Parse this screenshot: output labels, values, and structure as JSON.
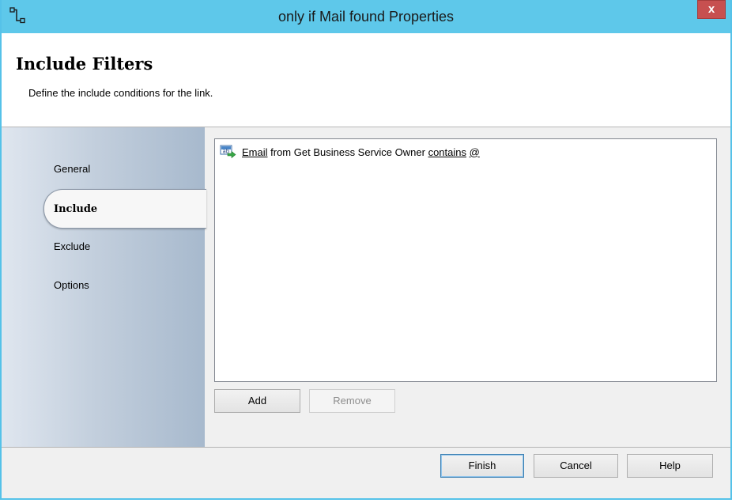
{
  "window": {
    "title": "only if Mail found Properties",
    "close_label": "x"
  },
  "header": {
    "title": "Include Filters",
    "subtitle": "Define the include conditions for the link."
  },
  "nav": {
    "items": [
      {
        "label": "General"
      },
      {
        "label": "Include",
        "selected": true
      },
      {
        "label": "Exclude"
      },
      {
        "label": "Options"
      }
    ]
  },
  "filters": {
    "rows": [
      {
        "icon": "string-filter-icon",
        "field": "Email",
        "source": "from Get Business Service Owner",
        "operator": "contains",
        "value": "@"
      }
    ],
    "add_label": "Add",
    "remove_label": "Remove"
  },
  "footer": {
    "finish_label": "Finish",
    "cancel_label": "Cancel",
    "help_label": "Help"
  },
  "colors": {
    "titlebar": "#5ec8ea",
    "close": "#c75050",
    "nav_gradient_end": "#a7b9cd"
  }
}
